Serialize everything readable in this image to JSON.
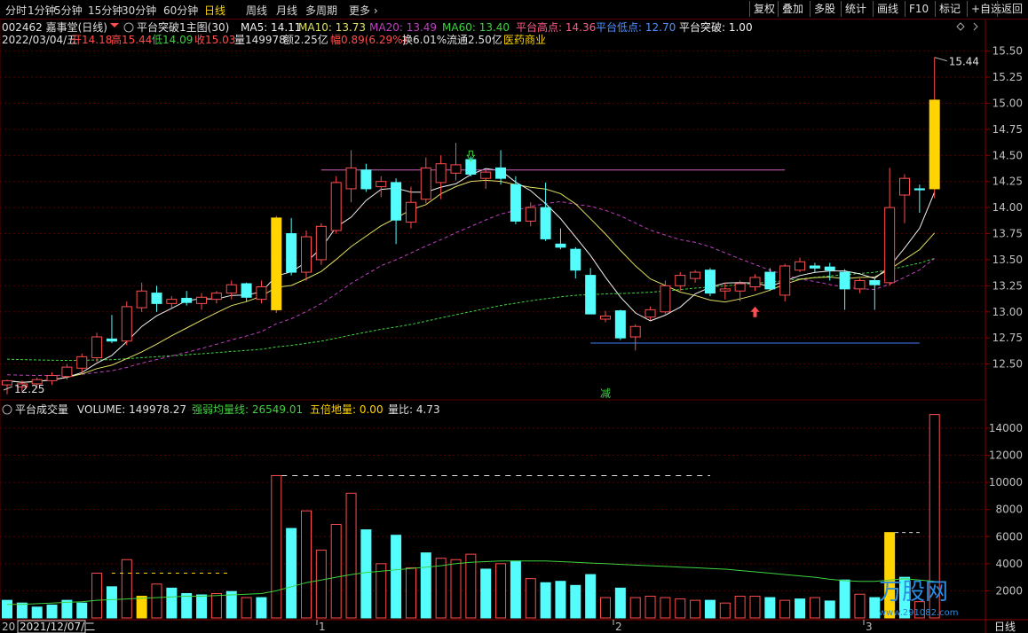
{
  "toolbar": {
    "periods": [
      "分时",
      "1分钟",
      "5分钟",
      "15分钟",
      "30分钟",
      "60分钟",
      "日线",
      "周线",
      "月线",
      "多周期",
      "更多"
    ],
    "active_period": "日线",
    "right_buttons": [
      "复权",
      "叠加",
      "多股",
      "统计",
      "画线",
      "F10",
      "标记",
      "+自选",
      "返回"
    ]
  },
  "main_header": {
    "stock": "002462 嘉事堂(日线)",
    "indicator": "平台突破1主图(30)",
    "ma5": "MA5: 14.11",
    "ma10": "MA10: 13.73",
    "ma20": "MA20: 13.49",
    "ma60": "MA60: 13.40",
    "platform_high": "平台高点: 14.36",
    "platform_low": "平台低点: 12.70",
    "platform_break": "平台突破: 1.00"
  },
  "quote": {
    "date": "2022/03/04/五",
    "open": "开14.18",
    "high": "高15.44",
    "low": "低14.09",
    "close": "收15.03",
    "volume": "量149978",
    "amount": "额2.25亿",
    "change": "幅0.89(6.29%)",
    "turnover": "换6.01%",
    "float": "流通2.50亿",
    "sector": "医药商业"
  },
  "chart_data": [
    {
      "type": "candlestick",
      "y_ticks": [
        15.5,
        15.25,
        15.0,
        14.75,
        14.5,
        14.25,
        14.0,
        13.75,
        13.5,
        13.25,
        13.0,
        12.75,
        12.5
      ],
      "y_tick_labels": [
        "15.50",
        "15.25",
        "15.00",
        "14.75",
        "14.50",
        "14.25",
        "14.00",
        "13.75",
        "13.50",
        "13.25",
        "13.00",
        "12.75",
        "12.50"
      ],
      "ylim": [
        12.25,
        15.65
      ],
      "series_labels": [
        "MA5",
        "MA10",
        "MA20",
        "MA60"
      ],
      "candles": [
        {
          "o": 12.3,
          "h": 12.35,
          "l": 12.21,
          "c": 12.34
        },
        {
          "o": 12.28,
          "h": 12.34,
          "l": 12.24,
          "c": 12.31
        },
        {
          "o": 12.31,
          "h": 12.37,
          "l": 12.27,
          "c": 12.35
        },
        {
          "o": 12.34,
          "h": 12.42,
          "l": 12.3,
          "c": 12.39
        },
        {
          "o": 12.38,
          "h": 12.5,
          "l": 12.35,
          "c": 12.47
        },
        {
          "o": 12.46,
          "h": 12.6,
          "l": 12.42,
          "c": 12.57
        },
        {
          "o": 12.56,
          "h": 12.8,
          "l": 12.52,
          "c": 12.76
        },
        {
          "o": 12.74,
          "h": 12.97,
          "l": 12.7,
          "c": 12.72
        },
        {
          "o": 12.72,
          "h": 13.1,
          "l": 12.68,
          "c": 13.05
        },
        {
          "o": 13.04,
          "h": 13.28,
          "l": 13.0,
          "c": 13.2
        },
        {
          "o": 13.18,
          "h": 13.25,
          "l": 13.0,
          "c": 13.08
        },
        {
          "o": 13.08,
          "h": 13.15,
          "l": 13.04,
          "c": 13.12
        },
        {
          "o": 13.13,
          "h": 13.2,
          "l": 13.06,
          "c": 13.09
        },
        {
          "o": 13.08,
          "h": 13.18,
          "l": 13.02,
          "c": 13.14
        },
        {
          "o": 13.12,
          "h": 13.2,
          "l": 13.08,
          "c": 13.18
        },
        {
          "o": 13.18,
          "h": 13.3,
          "l": 13.12,
          "c": 13.26
        },
        {
          "o": 13.27,
          "h": 13.28,
          "l": 13.1,
          "c": 13.14
        },
        {
          "o": 13.12,
          "h": 13.3,
          "l": 13.08,
          "c": 13.24
        },
        {
          "o": 13.02,
          "h": 13.92,
          "l": 12.99,
          "c": 13.9
        },
        {
          "o": 13.75,
          "h": 13.9,
          "l": 13.35,
          "c": 13.38
        },
        {
          "o": 13.38,
          "h": 13.78,
          "l": 13.3,
          "c": 13.72
        },
        {
          "o": 13.5,
          "h": 13.85,
          "l": 13.45,
          "c": 13.82
        },
        {
          "o": 13.78,
          "h": 14.3,
          "l": 13.75,
          "c": 14.24
        },
        {
          "o": 14.18,
          "h": 14.55,
          "l": 14.05,
          "c": 14.38
        },
        {
          "o": 14.36,
          "h": 14.42,
          "l": 14.15,
          "c": 14.18
        },
        {
          "o": 14.2,
          "h": 14.3,
          "l": 14.1,
          "c": 14.25
        },
        {
          "o": 14.24,
          "h": 14.28,
          "l": 13.65,
          "c": 13.88
        },
        {
          "o": 13.86,
          "h": 14.2,
          "l": 13.8,
          "c": 14.05
        },
        {
          "o": 14.08,
          "h": 14.48,
          "l": 14.04,
          "c": 14.38
        },
        {
          "o": 14.24,
          "h": 14.5,
          "l": 14.08,
          "c": 14.42
        },
        {
          "o": 14.33,
          "h": 14.62,
          "l": 14.26,
          "c": 14.41
        },
        {
          "o": 14.46,
          "h": 14.49,
          "l": 14.3,
          "c": 14.32
        },
        {
          "o": 14.28,
          "h": 14.36,
          "l": 14.18,
          "c": 14.34
        },
        {
          "o": 14.38,
          "h": 14.55,
          "l": 14.22,
          "c": 14.28
        },
        {
          "o": 14.22,
          "h": 14.3,
          "l": 13.84,
          "c": 13.87
        },
        {
          "o": 13.87,
          "h": 14.05,
          "l": 13.82,
          "c": 14.0
        },
        {
          "o": 14.0,
          "h": 14.24,
          "l": 13.68,
          "c": 13.7
        },
        {
          "o": 13.65,
          "h": 13.8,
          "l": 13.6,
          "c": 13.62
        },
        {
          "o": 13.6,
          "h": 13.62,
          "l": 13.32,
          "c": 13.4
        },
        {
          "o": 13.35,
          "h": 13.42,
          "l": 12.98,
          "c": 12.98
        },
        {
          "o": 12.93,
          "h": 13.01,
          "l": 12.9,
          "c": 12.96
        },
        {
          "o": 13.01,
          "h": 13.02,
          "l": 12.73,
          "c": 12.75
        },
        {
          "o": 12.76,
          "h": 12.88,
          "l": 12.63,
          "c": 12.86
        },
        {
          "o": 12.95,
          "h": 13.05,
          "l": 12.92,
          "c": 13.02
        },
        {
          "o": 13.0,
          "h": 13.3,
          "l": 12.98,
          "c": 13.25
        },
        {
          "o": 13.25,
          "h": 13.38,
          "l": 13.2,
          "c": 13.35
        },
        {
          "o": 13.32,
          "h": 13.4,
          "l": 13.28,
          "c": 13.38
        },
        {
          "o": 13.4,
          "h": 13.42,
          "l": 13.15,
          "c": 13.18
        },
        {
          "o": 13.2,
          "h": 13.28,
          "l": 13.12,
          "c": 13.22
        },
        {
          "o": 13.2,
          "h": 13.3,
          "l": 13.1,
          "c": 13.27
        },
        {
          "o": 13.24,
          "h": 13.36,
          "l": 13.2,
          "c": 13.33
        },
        {
          "o": 13.38,
          "h": 13.42,
          "l": 13.2,
          "c": 13.22
        },
        {
          "o": 13.16,
          "h": 13.46,
          "l": 13.1,
          "c": 13.44
        },
        {
          "o": 13.4,
          "h": 13.52,
          "l": 13.38,
          "c": 13.48
        },
        {
          "o": 13.44,
          "h": 13.47,
          "l": 13.38,
          "c": 13.42
        },
        {
          "o": 13.43,
          "h": 13.47,
          "l": 13.3,
          "c": 13.4
        },
        {
          "o": 13.38,
          "h": 13.41,
          "l": 13.02,
          "c": 13.22
        },
        {
          "o": 13.22,
          "h": 13.32,
          "l": 13.18,
          "c": 13.3
        },
        {
          "o": 13.3,
          "h": 13.32,
          "l": 13.02,
          "c": 13.26
        },
        {
          "o": 13.28,
          "h": 14.38,
          "l": 13.25,
          "c": 14.0
        },
        {
          "o": 14.12,
          "h": 14.32,
          "l": 13.85,
          "c": 14.28
        },
        {
          "o": 14.18,
          "h": 14.22,
          "l": 13.95,
          "c": 14.17
        },
        {
          "o": 14.18,
          "h": 15.44,
          "l": 14.09,
          "c": 15.03
        }
      ],
      "platform_high": 14.36,
      "platform_low": 12.7,
      "labels": {
        "high": "15.44",
        "low": "12.25",
        "reduce": "减"
      }
    },
    {
      "type": "bar",
      "name": "平台成交量",
      "y_ticks": [
        14000,
        12000,
        10000,
        8000,
        6000,
        4000,
        2000
      ],
      "y_tick_labels": [
        "14000",
        "12000",
        "10000",
        "8000",
        "6000",
        "4000",
        "2000"
      ],
      "ylim": [
        0,
        15500
      ],
      "values": [
        1300,
        1100,
        800,
        950,
        1300,
        1100,
        3300,
        2300,
        4300,
        1600,
        2500,
        2200,
        1800,
        1700,
        1800,
        1950,
        1500,
        1500,
        10500,
        6600,
        7900,
        5000,
        6900,
        9200,
        6500,
        4000,
        6100,
        3700,
        4800,
        4400,
        4300,
        4700,
        3600,
        4000,
        4200,
        2900,
        2600,
        2700,
        2400,
        3200,
        1500,
        2200,
        1500,
        1600,
        1500,
        1400,
        1300,
        1300,
        1100,
        1600,
        1600,
        1500,
        1300,
        1400,
        1500,
        1250,
        2800,
        1750,
        1500,
        6300,
        3000,
        1200,
        15000
      ],
      "ma": [
        1000,
        1000,
        1050,
        1100,
        1150,
        1200,
        1300,
        1350,
        1400,
        1450,
        1500,
        1550,
        1600,
        1600,
        1650,
        1700,
        1750,
        1800,
        2000,
        2300,
        2600,
        2800,
        3000,
        3200,
        3350,
        3450,
        3550,
        3650,
        3750,
        3850,
        4000,
        4100,
        4150,
        4200,
        4200,
        4200,
        4200,
        4150,
        4100,
        4050,
        4000,
        3950,
        3900,
        3850,
        3800,
        3750,
        3700,
        3650,
        3600,
        3500,
        3400,
        3300,
        3200,
        3100,
        3000,
        2850,
        2750,
        2700,
        2700,
        2800,
        2900,
        2800,
        2700
      ],
      "bar_colors": [
        "cyan",
        "cyan",
        "cyan",
        "cyan",
        "cyan",
        "cyan",
        "red",
        "cyan",
        "red",
        "yellow",
        "red",
        "cyan",
        "cyan",
        "cyan",
        "red",
        "cyan",
        "red",
        "cyan",
        "red",
        "cyan",
        "red",
        "red",
        "red",
        "red",
        "cyan",
        "red",
        "cyan",
        "red",
        "cyan",
        "red",
        "red",
        "red",
        "cyan",
        "red",
        "cyan",
        "red",
        "cyan",
        "cyan",
        "cyan",
        "cyan",
        "red",
        "cyan",
        "red",
        "red",
        "red",
        "red",
        "red",
        "cyan",
        "red",
        "red",
        "red",
        "cyan",
        "red",
        "cyan",
        "red",
        "cyan",
        "cyan",
        "red",
        "cyan",
        "yellow",
        "cyan",
        "red",
        "red"
      ]
    }
  ],
  "volume_header": {
    "title": "平台成交量",
    "volume": "VOLUME: 149978.27",
    "ma_line": "强弱均量线: 26549.01",
    "five_times": "五倍地量: 0.00",
    "ratio": "量比: 4.73"
  },
  "x_labels": [
    "20",
    "2021/12/07/二",
    "1",
    "2",
    "3"
  ],
  "bottom_tab": "日线",
  "watermark": {
    "name": "万股网",
    "url": "www.291082.com"
  }
}
